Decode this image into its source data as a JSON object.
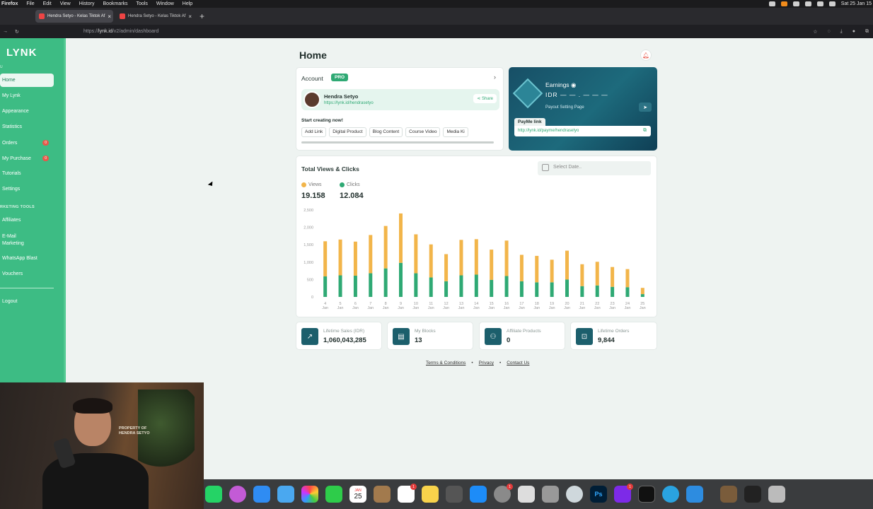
{
  "os": {
    "app_name": "Firefox",
    "menu": [
      "File",
      "Edit",
      "View",
      "History",
      "Bookmarks",
      "Tools",
      "Window",
      "Help"
    ],
    "clock": "Sat 25 Jan 15"
  },
  "browser": {
    "tabs": [
      {
        "label": "Hendra Setyo - Kelas Tiktok Af",
        "active": true
      },
      {
        "label": "Hendra Setyo - Kelas Tiktok Af",
        "active": false
      }
    ],
    "url_prefix": "https://",
    "url_host": "lynk.id",
    "url_path": "/v2/admin/dashboard"
  },
  "sidebar": {
    "logo": "LYNK",
    "section_main": "U",
    "items": [
      {
        "label": "Home",
        "active": true
      },
      {
        "label": "My Lynk"
      },
      {
        "label": "Appearance"
      },
      {
        "label": "Statistics"
      },
      {
        "label": "Orders",
        "badge": "0"
      },
      {
        "label": "My Purchase",
        "badge": "0"
      },
      {
        "label": "Tutorials"
      },
      {
        "label": "Settings"
      }
    ],
    "section_marketing": "RKETING TOOLS",
    "marketing": [
      {
        "label": "Affiliates"
      },
      {
        "label": "E-Mail Marketing"
      },
      {
        "label": "WhatsApp Blast"
      },
      {
        "label": "Vouchers"
      }
    ],
    "logout": "Logout"
  },
  "page": {
    "title": "Home"
  },
  "account": {
    "title": "Account",
    "badge": "PRO",
    "name": "Hendra Setyo",
    "link": "https://lynk.id/hendrasetyo",
    "share": "Share",
    "start_label": "Start creating now!",
    "chips": [
      "Add Link",
      "Digital Product",
      "Blog Content",
      "Course Video",
      "Media Ki"
    ]
  },
  "earnings": {
    "title": "Earnings",
    "value": "IDR — — . — — —",
    "payout": "Payout Setting Page",
    "payme_label": "PayMe link",
    "payme_url": "http://lynk.id/payme/hendrasetyo"
  },
  "views_card": {
    "title": "Total Views & Clicks",
    "date_placeholder": "Select Date..",
    "views_label": "Views",
    "clicks_label": "Clicks",
    "views_total": "19.158",
    "clicks_total": "12.084"
  },
  "chart_data": {
    "type": "bar",
    "stacked": true,
    "categories": [
      "4 Jan",
      "5 Jan",
      "6 Jan",
      "7 Jan",
      "8 Jan",
      "9 Jan",
      "10 Jan",
      "11 Jan",
      "12 Jan",
      "13 Jan",
      "14 Jan",
      "15 Jan",
      "16 Jan",
      "17 Jan",
      "18 Jan",
      "19 Jan",
      "20 Jan",
      "21 Jan",
      "22 Jan",
      "23 Jan",
      "24 Jan",
      "25 Jan"
    ],
    "series": [
      {
        "name": "Clicks",
        "color": "#2fa974",
        "values": [
          590,
          620,
          610,
          680,
          820,
          980,
          680,
          560,
          450,
          620,
          640,
          490,
          600,
          450,
          420,
          420,
          500,
          310,
          330,
          290,
          280,
          80
        ]
      },
      {
        "name": "Views",
        "color": "#f2b54a",
        "values": [
          1010,
          1030,
          980,
          1100,
          1220,
          1420,
          1120,
          950,
          780,
          1020,
          1020,
          870,
          1020,
          760,
          760,
          650,
          830,
          630,
          680,
          570,
          520,
          180
        ]
      }
    ],
    "yticks": [
      "0",
      "500",
      "1,000",
      "1,500",
      "2,000",
      "2,500"
    ],
    "ylim": [
      0,
      2500
    ]
  },
  "stats": [
    {
      "label": "Lifetime Sales (IDR)",
      "value": "1,060,043,285",
      "icon": "trend-icon"
    },
    {
      "label": "My Blocks",
      "value": "13",
      "icon": "blocks-icon"
    },
    {
      "label": "Affiliate Products",
      "value": "0",
      "icon": "people-icon"
    },
    {
      "label": "Lifetime Orders",
      "value": "9,844",
      "icon": "cart-icon"
    }
  ],
  "footer": [
    "Terms & Conditions",
    "Privacy",
    "Contact Us"
  ],
  "webcam": {
    "overlay_text_1": "PROPERTY OF",
    "overlay_text_2": "HENDRA SETYO"
  },
  "dock": {
    "calendar_month": "JAN",
    "calendar_day": "25",
    "mail_badge": "1",
    "reminders_badge": "1",
    "canva_badge": "1"
  },
  "colors": {
    "brand": "#3dbc84",
    "views": "#f2b54a",
    "clicks": "#2fa974",
    "earn_bg": "#174f66"
  }
}
